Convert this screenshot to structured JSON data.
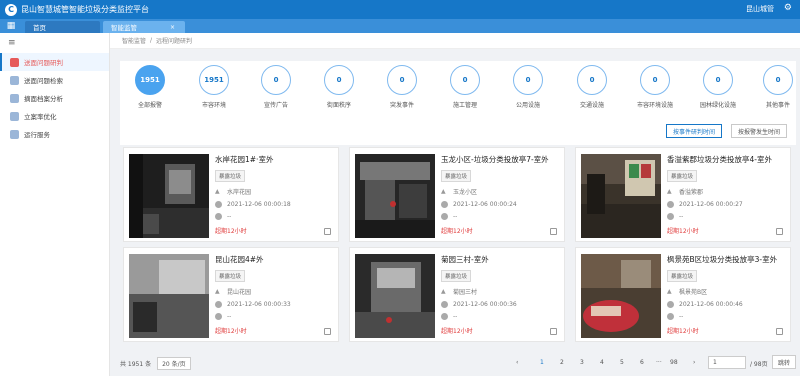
{
  "app": {
    "title": "昆山智慧城管智能垃圾分类监控平台",
    "user": "昆山城管"
  },
  "tabs": [
    {
      "label": "首页"
    },
    {
      "label": "智能监管",
      "close": "×"
    }
  ],
  "sidebar": {
    "items": [
      {
        "label": "送面问题研判"
      },
      {
        "label": "送面问题检索"
      },
      {
        "label": "摘面档案分析"
      },
      {
        "label": "立案率优化"
      },
      {
        "label": "运行服务"
      }
    ]
  },
  "breadcrumb": {
    "parent": "智能监管",
    "sep": "/",
    "current": "远程问题研判"
  },
  "stats": [
    {
      "value": "1951",
      "label": "全部报警"
    },
    {
      "value": "1951",
      "label": "市容环境"
    },
    {
      "value": "0",
      "label": "宣传广告"
    },
    {
      "value": "0",
      "label": "街面秩序"
    },
    {
      "value": "0",
      "label": "突发事件"
    },
    {
      "value": "0",
      "label": "施工管理"
    },
    {
      "value": "0",
      "label": "公用设施"
    },
    {
      "value": "0",
      "label": "交通设施"
    },
    {
      "value": "0",
      "label": "市容环境设施"
    },
    {
      "value": "0",
      "label": "园林绿化设施"
    },
    {
      "value": "0",
      "label": "其他事件"
    }
  ],
  "sort": {
    "by_report": "按事件研判时间",
    "by_occur": "按报警发生时间"
  },
  "cards": [
    {
      "title": "水岸花园1#·室外",
      "tag": "暴露垃圾",
      "place": "水岸花园",
      "time": "2021-12-06 00:00:18",
      "note": "--",
      "over": "超期12小时"
    },
    {
      "title": "玉龙小区-垃圾分类投放亭7-室外",
      "tag": "暴露垃圾",
      "place": "玉龙小区",
      "time": "2021-12-06 00:00:24",
      "note": "--",
      "over": "超期12小时"
    },
    {
      "title": "香溢紫郡垃圾分类投放亭4-室外",
      "tag": "暴露垃圾",
      "place": "香溢紫郡",
      "time": "2021-12-06 00:00:27",
      "note": "--",
      "over": "超期12小时"
    },
    {
      "title": "昆山花园4#外",
      "tag": "暴露垃圾",
      "place": "昆山花园",
      "time": "2021-12-06 00:00:33",
      "note": "--",
      "over": "超期12小时"
    },
    {
      "title": "菊园三村-室外",
      "tag": "暴露垃圾",
      "place": "菊园三村",
      "time": "2021-12-06 00:00:36",
      "note": "--",
      "over": "超期12小时"
    },
    {
      "title": "枫景苑B区垃圾分类投放亭3-室外",
      "tag": "暴露垃圾",
      "place": "枫景苑B区",
      "time": "2021-12-06 00:00:46",
      "note": "--",
      "over": "超期12小时"
    }
  ],
  "pager": {
    "total_text": "共 1951 条",
    "page_size": "20 条/页",
    "pages": [
      "1",
      "2",
      "3",
      "4",
      "5",
      "6",
      "98"
    ],
    "prev": "‹",
    "next": "›",
    "ellipsis": "···",
    "goto_value": "1",
    "total_pages": "/ 98页",
    "jump": "跳转"
  }
}
